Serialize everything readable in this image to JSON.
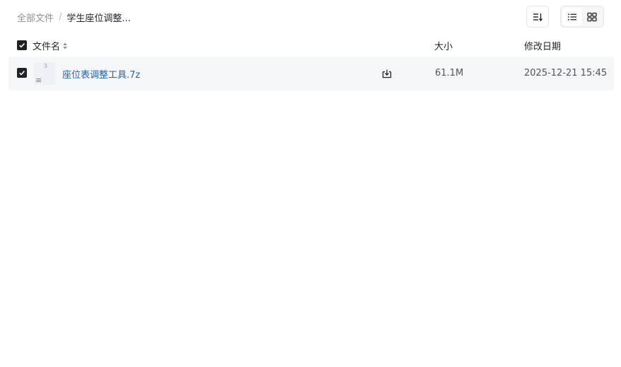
{
  "breadcrumb": {
    "root": "全部文件",
    "separator": "/",
    "current": "学生座位调整..."
  },
  "toolbar": {
    "sort_icon": "sort-list-icon",
    "view_list_icon": "list-view-icon",
    "view_grid_icon": "grid-view-icon",
    "active_view": "list"
  },
  "table": {
    "columns": {
      "name": "文件名",
      "size": "大小",
      "modified": "修改日期"
    },
    "header_checked": true,
    "rows": [
      {
        "checked": true,
        "icon": "7z-archive-file-icon",
        "name": "座位表调整工具.7z",
        "size": "61.1M",
        "modified": "2025-12-21 15:45"
      }
    ]
  },
  "colors": {
    "link": "#2a5fae",
    "row_bg": "#f5f6f7",
    "checkbox": "#1f2329"
  }
}
